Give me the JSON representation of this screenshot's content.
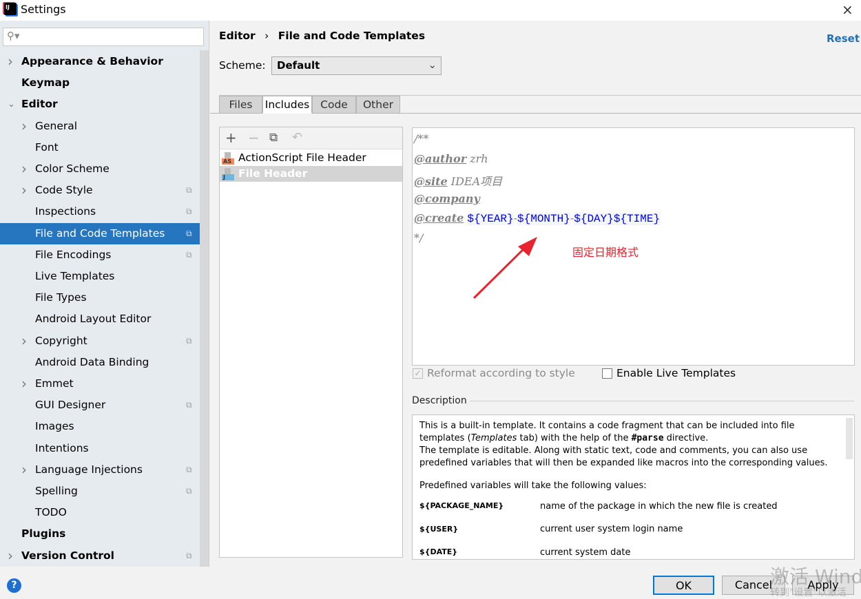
{
  "window": {
    "title": "Settings",
    "app_icon": "intellij-icon",
    "close_icon": "×"
  },
  "sidebar": {
    "search_placeholder": "",
    "items": [
      {
        "label": "Appearance & Behavior",
        "level": 0,
        "bold": true,
        "arrow": "right"
      },
      {
        "label": "Keymap",
        "level": 0,
        "bold": true
      },
      {
        "label": "Editor",
        "level": 0,
        "bold": true,
        "arrow": "down"
      },
      {
        "label": "General",
        "level": 1,
        "arrow": "right"
      },
      {
        "label": "Font",
        "level": 1
      },
      {
        "label": "Color Scheme",
        "level": 1,
        "arrow": "right"
      },
      {
        "label": "Code Style",
        "level": 1,
        "arrow": "right",
        "project_icon": true
      },
      {
        "label": "Inspections",
        "level": 1,
        "project_icon": true
      },
      {
        "label": "File and Code Templates",
        "level": 1,
        "project_icon": true,
        "selected": true
      },
      {
        "label": "File Encodings",
        "level": 1,
        "project_icon": true
      },
      {
        "label": "Live Templates",
        "level": 1
      },
      {
        "label": "File Types",
        "level": 1
      },
      {
        "label": "Android Layout Editor",
        "level": 1
      },
      {
        "label": "Copyright",
        "level": 1,
        "arrow": "right",
        "project_icon": true
      },
      {
        "label": "Android Data Binding",
        "level": 1
      },
      {
        "label": "Emmet",
        "level": 1,
        "arrow": "right"
      },
      {
        "label": "GUI Designer",
        "level": 1,
        "project_icon": true
      },
      {
        "label": "Images",
        "level": 1
      },
      {
        "label": "Intentions",
        "level": 1
      },
      {
        "label": "Language Injections",
        "level": 1,
        "arrow": "right",
        "project_icon": true
      },
      {
        "label": "Spelling",
        "level": 1,
        "project_icon": true
      },
      {
        "label": "TODO",
        "level": 1
      },
      {
        "label": "Plugins",
        "level": 0,
        "bold": true
      },
      {
        "label": "Version Control",
        "level": 0,
        "bold": true,
        "arrow": "right",
        "project_icon": true
      }
    ]
  },
  "header": {
    "breadcrumb": [
      "Editor",
      "File and Code Templates"
    ],
    "reset": "Reset"
  },
  "scheme": {
    "label": "Scheme:",
    "value": "Default"
  },
  "tabs": [
    {
      "label": "Files"
    },
    {
      "label": "Includes",
      "active": true
    },
    {
      "label": "Code"
    },
    {
      "label": "Other"
    }
  ],
  "templates": {
    "toolbar": [
      "add-icon",
      "remove-icon",
      "copy-icon",
      "reset-icon"
    ],
    "items": [
      {
        "label": "ActionScript File Header",
        "badge": "AS",
        "badge_color": "#f08a5d"
      },
      {
        "label": "File Header",
        "badge": "J",
        "badge_color": "#6cb8df",
        "selected": true
      }
    ]
  },
  "editor": {
    "line0": "/**",
    "author_tag": "@author",
    "author_val": " zrh",
    "site_tag": "@site",
    "site_val": " IDEA项目",
    "company_tag": "@company",
    "create_tag": "@create",
    "vars": [
      "${YEAR}",
      "${MONTH}",
      "${DAY}",
      "${TIME}"
    ],
    "sep": "-",
    "end": "*/"
  },
  "annotation": {
    "text": "固定日期格式",
    "color": "#e8242e"
  },
  "options": {
    "reformat": "Reformat according to style",
    "reformat_checked": true,
    "reformat_disabled": true,
    "live": "Enable Live Templates",
    "live_checked": false
  },
  "description": {
    "label": "Description",
    "p1a": "This is a built-in template. It contains a code fragment that can be included into file templates (",
    "p1i": "Templates",
    "p1b": " tab) with the help of the ",
    "p1c": "#parse",
    "p1d": " directive.",
    "p2": "The template is editable. Along with static text, code and comments, you can also use predefined variables that will then be expanded like macros into the corresponding values.",
    "p3": "Predefined variables will take the following values:",
    "vars": [
      {
        "name": "${PACKAGE_NAME}",
        "desc": "name of the package in which the new file is created"
      },
      {
        "name": "${USER}",
        "desc": "current user system login name"
      },
      {
        "name": "${DATE}",
        "desc": "current system date"
      }
    ]
  },
  "buttons": {
    "ok": "OK",
    "cancel": "Cancel",
    "apply": "Apply",
    "help": "?"
  },
  "watermark": {
    "line1": "激活 Windo",
    "line2": "转到\"设置\"以激活"
  }
}
